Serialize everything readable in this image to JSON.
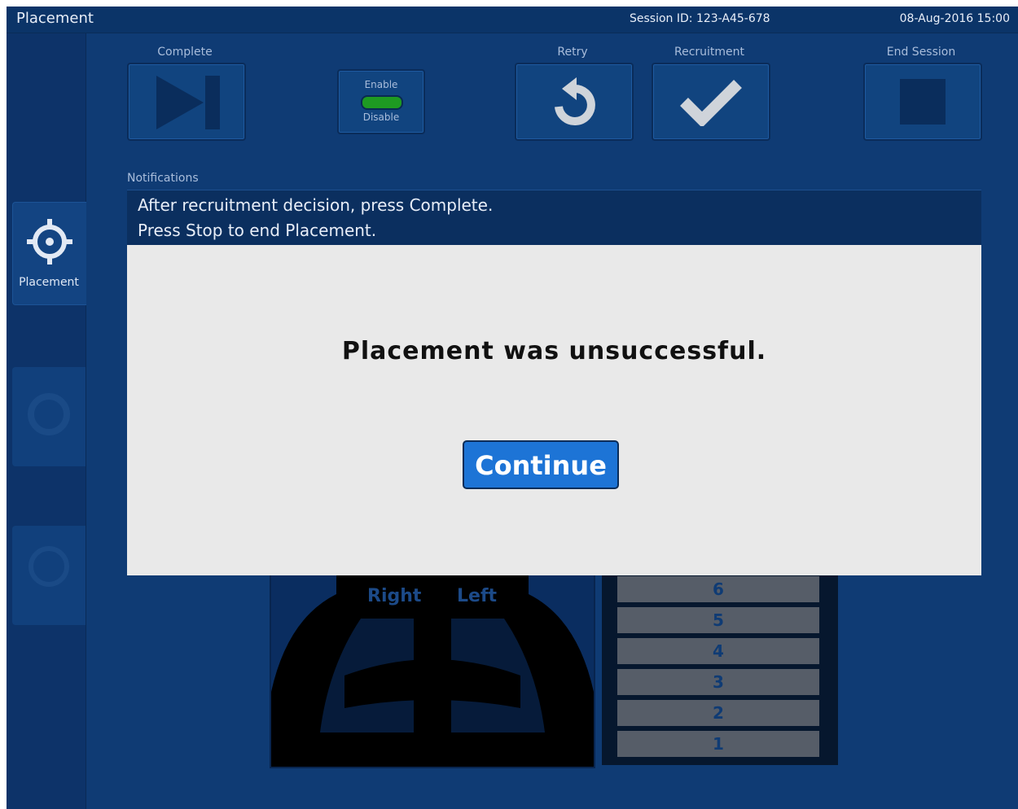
{
  "titlebar": {
    "title": "Placement",
    "session": "Session ID: 123-A45-678",
    "datetime": "08-Aug-2016  15:00"
  },
  "sidebar": {
    "items": [
      {
        "label": "Placement",
        "icon": "crosshair-target-icon",
        "active": true
      },
      {
        "label": "",
        "icon": "gear-icon",
        "active": false
      },
      {
        "label": "",
        "icon": "ring-icon",
        "active": false
      }
    ]
  },
  "toolbar": {
    "complete_label": "Complete",
    "toggle_enable": "Enable",
    "toggle_disable": "Disable",
    "retry_label": "Retry",
    "recruitment_label": "Recruitment",
    "end_session_label": "End Session"
  },
  "notifications": {
    "label": "Notifications",
    "lines": [
      "After recruitment decision, press Complete.",
      "Press Stop to end Placement."
    ]
  },
  "lung_view": {
    "right_label": "Right",
    "left_label": "Left"
  },
  "levels": [
    "6",
    "5",
    "4",
    "3",
    "2",
    "1"
  ],
  "dialog": {
    "message": "Placement was unsuccessful.",
    "continue_label": "Continue"
  },
  "colors": {
    "background": "#0f3b74",
    "toggle_on": "#1e9a22",
    "continue_button": "#1d74d6",
    "dialog_bg": "#e9e9e9"
  }
}
